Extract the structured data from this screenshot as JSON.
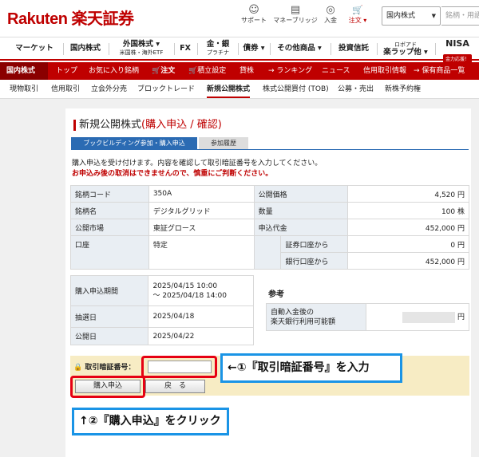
{
  "header": {
    "logo": "Rakuten 楽天証券",
    "icons": [
      {
        "name": "support-icon",
        "glyph": "☺",
        "label": "サポート"
      },
      {
        "name": "money-bridge-icon",
        "glyph": "▤",
        "label": "マネーブリッジ"
      },
      {
        "name": "deposit-icon",
        "glyph": "◎",
        "label": "入金"
      },
      {
        "name": "order-cart-icon",
        "glyph": "🛒",
        "label": "注文 ▾"
      }
    ],
    "market_select": "国内株式",
    "search_placeholder": "銘柄・用語"
  },
  "top_nav": {
    "items": [
      {
        "label": "マーケット",
        "sub": ""
      },
      {
        "label": "国内株式",
        "sub": ""
      },
      {
        "label": "外国株式 ▾",
        "sub": "米国株・海外ETF"
      },
      {
        "label": "FX",
        "sub": ""
      },
      {
        "label": "金・銀",
        "sub": "プラチナ"
      },
      {
        "label": "債券 ▾",
        "sub": ""
      },
      {
        "label": "その他商品 ▾",
        "sub": ""
      },
      {
        "label": "投資信託",
        "sub": ""
      },
      {
        "label": "ロボアド",
        "sub": "楽ラップ他 ▾"
      }
    ],
    "nisa": "NISA",
    "nisa_badge": "金力応援！"
  },
  "red_nav": {
    "current": "国内株式",
    "items": [
      "トップ",
      "お気に入り銘柄",
      "注文",
      "積立設定",
      "貸株",
      "→ ランキング",
      "ニュース",
      "信用取引情報",
      "→ 保有商品一覧"
    ]
  },
  "sub_nav": {
    "items": [
      "現物取引",
      "信用取引",
      "立会外分売",
      "ブロックトレード",
      "新規公開株式",
      "株式公開買付 (TOB)",
      "公募・売出",
      "新株予約権"
    ],
    "current_index": 4
  },
  "page": {
    "title_prefix": "新規公開株式",
    "title_red": "(購入申込 / 確認)",
    "tab_active": "ブックビルディング参加・購入申込",
    "tab_inactive": "参加履歴",
    "message": "購入申込を受け付けます。内容を確認して取引暗証番号を入力してください。",
    "warning": "お申込み後の取消はできませんので、慎重にご判断ください。"
  },
  "info": {
    "code_label": "銘柄コード",
    "code": "350A",
    "name_label": "銘柄名",
    "name": "デジタルグリッド",
    "market_label": "公開市場",
    "market": "東証グロース",
    "account_label": "口座",
    "account": "特定",
    "price_label": "公開価格",
    "price": "4,520 円",
    "qty_label": "数量",
    "qty": "100 株",
    "amount_label": "申込代金",
    "amount": "452,000 円",
    "from_securities_label": "証券口座から",
    "from_securities": "0 円",
    "from_bank_label": "銀行口座から",
    "from_bank": "452,000 円"
  },
  "period": {
    "apply_label": "購入申込期間",
    "apply_line1": "2025/04/15 10:00",
    "apply_line2": "～ 2025/04/18 14:00",
    "lottery_label": "抽選日",
    "lottery": "2025/04/18",
    "listing_label": "公開日",
    "listing": "2025/04/22"
  },
  "reference": {
    "title": "参考",
    "label_line1": "自動入金後の",
    "label_line2": "楽天銀行利用可能額",
    "unit": "円"
  },
  "form": {
    "pin_label": "取引暗証番号：",
    "pin_value": "",
    "buy_button": "購入申込",
    "back_button": "戻　る"
  },
  "annotations": {
    "step1": "←①『取引暗証番号』を入力",
    "step2": "↑②『購入申込』をクリック",
    "highlight_color": "#e60012",
    "callout_color": "#1a94e6"
  }
}
